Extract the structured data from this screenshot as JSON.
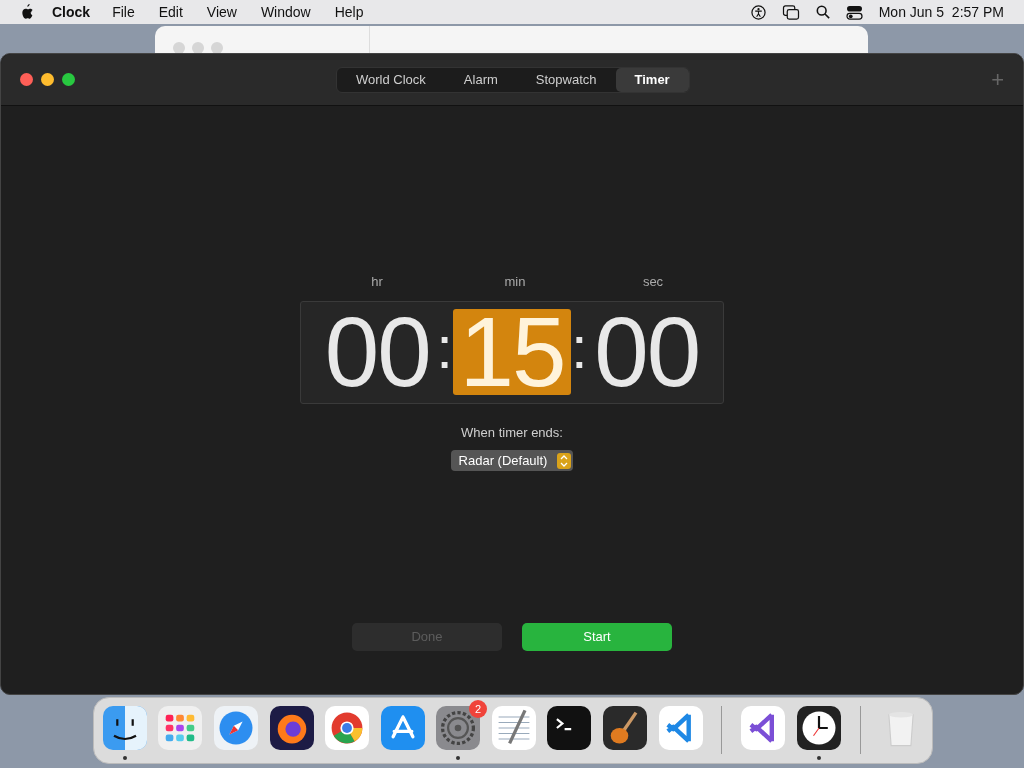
{
  "menu_bar": {
    "app": "Clock",
    "items": [
      "File",
      "Edit",
      "View",
      "Window",
      "Help"
    ],
    "clock": "Mon Jun 5  2:57 PM"
  },
  "tabs": [
    {
      "label": "World Clock",
      "selected": false
    },
    {
      "label": "Alarm",
      "selected": false
    },
    {
      "label": "Stopwatch",
      "selected": false
    },
    {
      "label": "Timer",
      "selected": true
    }
  ],
  "add_button": "+",
  "timer": {
    "fields": [
      {
        "label": "hr",
        "value": "00",
        "selected": false
      },
      {
        "label": "min",
        "value": "15",
        "selected": true
      },
      {
        "label": "sec",
        "value": "00",
        "selected": false
      }
    ],
    "separator": ":",
    "sound_label": "When timer ends:",
    "sound": "Radar (Default)"
  },
  "buttons": [
    {
      "label": "Done",
      "disabled": true,
      "kind": "secondary"
    },
    {
      "label": "Start",
      "disabled": false,
      "kind": "primary"
    }
  ],
  "dock": [
    {
      "kind": "finder",
      "running": true
    },
    {
      "kind": "launchpad",
      "running": false
    },
    {
      "kind": "safari",
      "running": false
    },
    {
      "kind": "firefox",
      "running": false
    },
    {
      "kind": "chrome",
      "running": false
    },
    {
      "kind": "appstore",
      "running": false
    },
    {
      "kind": "settings",
      "running": true,
      "badge": "2"
    },
    {
      "kind": "textedit",
      "running": false
    },
    {
      "kind": "terminal",
      "running": false
    },
    {
      "kind": "garageband",
      "running": false
    },
    {
      "kind": "vscode",
      "running": false
    },
    {
      "kind": "divider"
    },
    {
      "kind": "visualstudio",
      "running": false
    },
    {
      "kind": "clock",
      "running": true
    },
    {
      "kind": "divider"
    },
    {
      "kind": "trash",
      "running": false
    }
  ]
}
